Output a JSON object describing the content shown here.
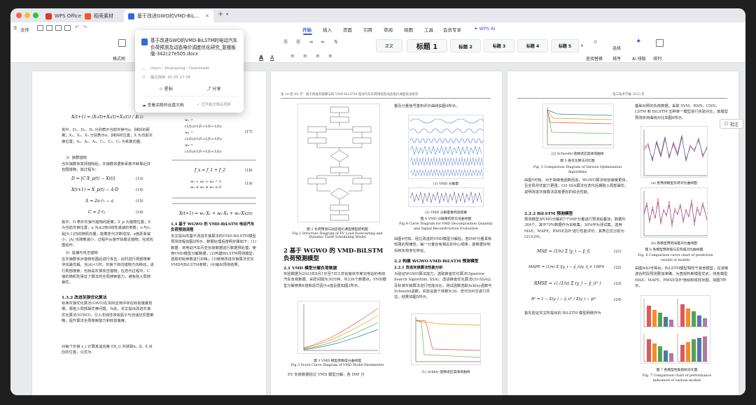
{
  "tabs": [
    {
      "label": "WPS Office"
    },
    {
      "label": "稻壳素材"
    },
    {
      "label": "基于改进GWO的VMD-BiL..."
    }
  ],
  "menu": {
    "file": "文件",
    "tabs": [
      "开始",
      "插入",
      "页面",
      "引用",
      "审阅",
      "视图",
      "工具",
      "会员专享"
    ],
    "ai": "WPS AI"
  },
  "ribbon": {
    "format_painter": "格式刷",
    "styles": [
      "正文",
      "标题 1",
      "标题 2",
      "标题 3",
      "标题 4",
      "标题 5"
    ],
    "find_replace": "查找替换",
    "select": "选择",
    "sort": "排序",
    "ai_layout": "AI 排版",
    "arrange": "排列"
  },
  "popup": {
    "title": "基于改进GWO的VMD-BiLSTM的电动汽车负荷预测及动态电价调度优化研究_复模板版-342c27e505.docx",
    "path": "Users › zhujinpeng › Downloads",
    "saved": "最近保存: 01-05 17:38",
    "star": "星标",
    "share": "分享",
    "cloud_link": "查看关联的云盘文档",
    "sync": "已开启文档云同步"
  },
  "comments_btn": "批注",
  "doc": {
    "p1": {
      "eq12": "X(t+1) = (X₁(t)+X₂(t)+X₃(t)) / 3",
      "eq12n": "(12)",
      "para1": "其中，D₁、D₂、D₃ 分别表示当前灰狼与α、β和δ的距离；X₁、X₂、X₃ 分别表示α、β和δ的位置；X 为当前灰狼位置；A₁、A₂、A₃、C₁、C₂、C₃ 为系数向量。",
      "sec3": "3）狼群猎物",
      "para2": "当灰狼群体发现猎物后，灰狼群体更新系数不断靠近并包围猎物，其过程为：",
      "eq13": "D = |C·X_p(t) − X(t)|",
      "eq13n": "(13)",
      "eq14": "X(t+1) = X_p(t) − A·D",
      "eq14n": "(14)",
      "eq15": "A = 2a·r₁ − a",
      "eq15n": "(15)",
      "eq16": "C = 2·r₂",
      "eq16n": "(16)",
      "para3": "其中，D 表示灰狼与猎物的距离；X_p 为猎物位置；X 为当前灰狼位置，a 为从2到0线性递减的参数；r₁与r₂是[0,1]内的随机向量，能着迭代次数增加，a值逐渐减小，|A| 也随着减小，过程中从狼开始靠近猎物，完成包围动作。",
      "sec4": "4）追捕与攻击猎物",
      "para4": "在灰狼群体对猎物包围后进行攻击，此时进行局部搜索寻找最优解。当|A|<1时，灰狼个体向猎物方向移动，进行局部搜索，也就是灰狼攻击猎物；在迭代过程中，C 值的随机性保证了算法的全局搜索能力，避免陷入局部最优。",
      "sec13": "1.3.2 改进灰狼优化算法",
      "para5": "标准灰狼优化算法(GWO)在实际应用中存在收敛速度较慢、易陷入局部最优等问题。为此，本文提出改进灰狼优化算法(IGWO)，引入非线性收敛因子与自适应权重策略，提升算法全局搜索能力和收敛速度。",
      "para6": "对每个灰狼 x_i 计算其适应度 f(X_i) 并获取α、β、δ 对应的位置，公式为："
    },
    "p2": {
      "head": "第 19 卷    XX 学：基于改进灰狼算法的 VMD-BiLSTM 电动汽车负荷预测及动态电价调度优化研究",
      "eq17n": "(17)",
      "eq18": "f_s = f_1 + f_2",
      "eq18n": "(18)",
      "eq19n": "(19)",
      "eq20": "X(t+1) = w₁·X₁ + w₂·X₂ + w₃·X₃",
      "eq20n": "(20)",
      "para1": "其中：f₁、f₂ 为适应度值；w 为各灰狼权重。",
      "para2": "基于适应度的动态权重策略，计算种群新 w 值的位置：",
      "sec14": "1.4 基于 WGWO 的 VMD-BiLSTM 电动汽车负荷预测流程",
      "para3": "本文提出的基于改进灰狼算法的VMD-BiLSTM模型预测流程如图2所示，数据处理后按照步骤如下：(1)数据：将电动汽车历史负荷数据进行数据预处理，使用VMD模型分解数据；(2)构建BiLSTM预测模型，选取初始参数进行训练；(3)使用改进灰狼算法优化VMD与BiLSTM参数；(4)输出预测结果。",
      "fig2cap": "图 2 负荷预测与动态电价调度模型结构图",
      "fig2cap_en": "Fig.2 Structure Diagram of EV Load Forecasting and Dynamic Tariff Scheduling Model",
      "h2": "2 基于 WGWO 的 VMD-BiLSTM 负荷预测模型",
      "sec21": "2.1 VMD 模型分解负荷数据",
      "para4": "实验数据为2023年8月1日至7日江苏省南京市某充电站的电动汽车负荷数据，采样间隔为30分钟，共336个数据点。VMD模型分解参数K值和惩罚因子α值设置如图3所示。",
      "fig3cap": "图 3 VMD 模型参数得分曲线图",
      "fig3cap_en": "Fig.3 Score Curve Diagram of VMD Model Parameters",
      "para5": "EV 负荷数据经过 VMD 模型分解，各 IMF 分",
      "fig4cap": "图 4 VMD 分解重构后信号曲线图",
      "fig4cap_en": "Fig.4 Curve Diagram for VMD Decomposition Quantity and Signal Reconstruction Evaluation",
      "sub_a": "(1) VMD 分解量",
      "sub_b": "(2) VMD 分解量重构后结果",
      "para6": "量及分量信号重构评价曲线如图4所示。",
      "para7": "由图4可知，经过改进的VMD模型分解后，各IMF分量具有较强的规律性，每一分量含有相近的中心频率，能够更好地反映负荷变化特征。",
      "sec22": "2.2 构建 WGWO-VMD-BiLSTM 预测模型",
      "sec221": "2.2.1 改进灰狼算法性能分析",
      "para8": "为验证WGWO算法能力，选取麻雀优化算法(Sparrow Search Algorithm, SSA)、改进麻雀优化算法CO-SSA以及标准灰狼算法进行性能对比，测试函数选取Ackley函数与Schwefel函数，实验设置个体数为30，迭代500次进行评估，结果如图5所示。",
      "fig5sub": "(1) Ackley 函数适应度收敛曲线"
    },
    "p3": {
      "head": "电工技术学报              2023 年",
      "fig5sub2": "(2) Schwefel 函数适应度收敛曲线",
      "fig5cap": "图 5 各优化算法对比图",
      "fig5cap_en": "Fig. 5 Comparison Diagram of Various Optimization Algorithms",
      "para1": "由图5可知，对于高峰值函数而言，WGWO算法收敛速度更快，且全局寻优能力更强；CO-SSA算法在迭代后期陷入局部最优，说明改进灰狼算法具有更好的综合性能。",
      "sec222": "2.2.2 BiLSTM 预测模型",
      "para2": "预测模型对VMD分解的7个IMF分量进行预测后叠加，数据共384个，其中70%数据作为训练集，30%作为测试集，选用MAE、MAPE、RMSE及R²进行性能评价，其表达式分别为(21)(24)。",
      "eq21": "MAE = (1/n) Σ |y_i − ŷ_i|",
      "eq21n": "(21)",
      "eq22": "MAPE = (1/n) Σ |(y_i − ŷ_i)/y_i| × 100%",
      "eq22n": "(22)",
      "eq23": "RMSE = √( (1/n) Σ (y_i − ŷ_i)² )",
      "eq23n": "(23)",
      "eq24": "R² = 1 − Σ(y_i − ŷ_i)² / Σ(y_i − ȳ)²",
      "eq24n": "(24)",
      "para3": "首先验证本文所提出的 BiLSTM 模型网络作为",
      "col2p1": "基础对照的负荷数据，采取 SVM、RNN、CNN、LSTM 和 BiLSTM 五种单一模型进行实验对比，其模型预测负荷曲线对比如图6所示。",
      "fig6a": "(a) 各预测模型负荷对比曲线图",
      "fig6b": "(b) 各模型预测误差对比曲线图",
      "fig6cap": "图 6 各模型预测值与实际值对比曲线图",
      "fig6cap_en": "Fig. 6 Comparison curve chart of prediction results of models",
      "para4": "由图6(b)可得出，BiLSTM模型相较于其他模型，在波峰波谷时段预测更加准确，为直观判断模型优劣，将各模型MAE、MAPE、RMSE及R²值绘制成柱状图，如图7所示。",
      "fig7cap": "图 7 各模型性能指标对比图",
      "fig7cap_en": "Fig. 7 Comparison chart of performance indicators of various models"
    }
  }
}
